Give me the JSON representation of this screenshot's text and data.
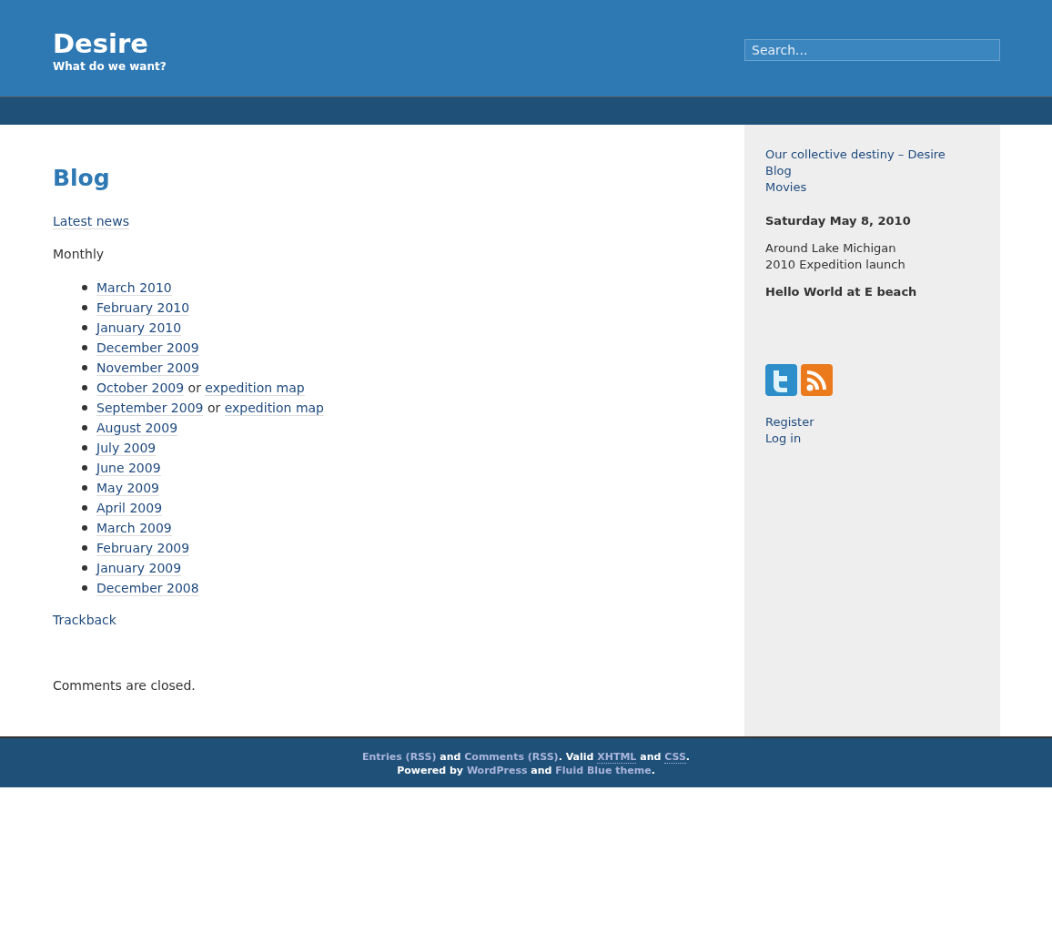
{
  "header": {
    "title": "Desire",
    "tagline": "What do we want?",
    "search": {
      "placeholder": "Search..."
    }
  },
  "post": {
    "title": "Blog",
    "intro_link": "Latest news",
    "section_label": "Monthly",
    "archives": [
      [
        {
          "kind": "link",
          "text": "March 2010"
        }
      ],
      [
        {
          "kind": "link",
          "text": "February 2010"
        }
      ],
      [
        {
          "kind": "link",
          "text": "January 2010"
        }
      ],
      [
        {
          "kind": "link",
          "text": "December 2009"
        }
      ],
      [
        {
          "kind": "link",
          "text": "November 2009"
        }
      ],
      [
        {
          "kind": "link",
          "text": "October 2009"
        },
        {
          "kind": "text",
          "text": "or"
        },
        {
          "kind": "link",
          "text": "expedition map"
        }
      ],
      [
        {
          "kind": "link",
          "text": "September 2009"
        },
        {
          "kind": "text",
          "text": "or"
        },
        {
          "kind": "link",
          "text": "expedition map"
        }
      ],
      [
        {
          "kind": "link",
          "text": "August 2009"
        }
      ],
      [
        {
          "kind": "link",
          "text": "July 2009"
        }
      ],
      [
        {
          "kind": "link",
          "text": "June 2009"
        }
      ],
      [
        {
          "kind": "link",
          "text": "May 2009"
        }
      ],
      [
        {
          "kind": "link",
          "text": "April 2009"
        }
      ],
      [
        {
          "kind": "link",
          "text": "March 2009"
        }
      ],
      [
        {
          "kind": "link",
          "text": "February 2009"
        }
      ],
      [
        {
          "kind": "link",
          "text": "January 2009"
        }
      ],
      [
        {
          "kind": "link",
          "text": "December 2008"
        }
      ]
    ],
    "trackback": "Trackback",
    "comments_note": "Comments are closed."
  },
  "sidebar": {
    "pages": [
      "Our collective destiny – Desire",
      "Blog",
      "Movies"
    ],
    "date": "Saturday May 8, 2010",
    "posts": [
      {
        "kind": "plain",
        "text": "Around Lake Michigan"
      },
      {
        "kind": "plain",
        "text": "2010 Expedition launch"
      },
      {
        "kind": "bold",
        "text": "Hello World at E beach"
      }
    ],
    "social": [
      {
        "kind": "twitter"
      },
      {
        "kind": "rss"
      }
    ],
    "meta": [
      "Register",
      "Log in"
    ]
  },
  "footer": {
    "lines": [
      [
        {
          "kind": "link",
          "text": "Entries (RSS)"
        },
        {
          "kind": "text",
          "text": " and "
        },
        {
          "kind": "link",
          "text": "Comments (RSS)"
        },
        {
          "kind": "text",
          "text": ". Valid "
        },
        {
          "kind": "abbr",
          "text": "XHTML"
        },
        {
          "kind": "text",
          "text": " and "
        },
        {
          "kind": "abbr",
          "text": "CSS"
        },
        {
          "kind": "text",
          "text": "."
        }
      ],
      [
        {
          "kind": "text",
          "text": "Powered by "
        },
        {
          "kind": "link",
          "text": "WordPress"
        },
        {
          "kind": "text",
          "text": " and "
        },
        {
          "kind": "link",
          "text": "Fluid Blue theme"
        },
        {
          "kind": "text",
          "text": "."
        }
      ]
    ]
  }
}
